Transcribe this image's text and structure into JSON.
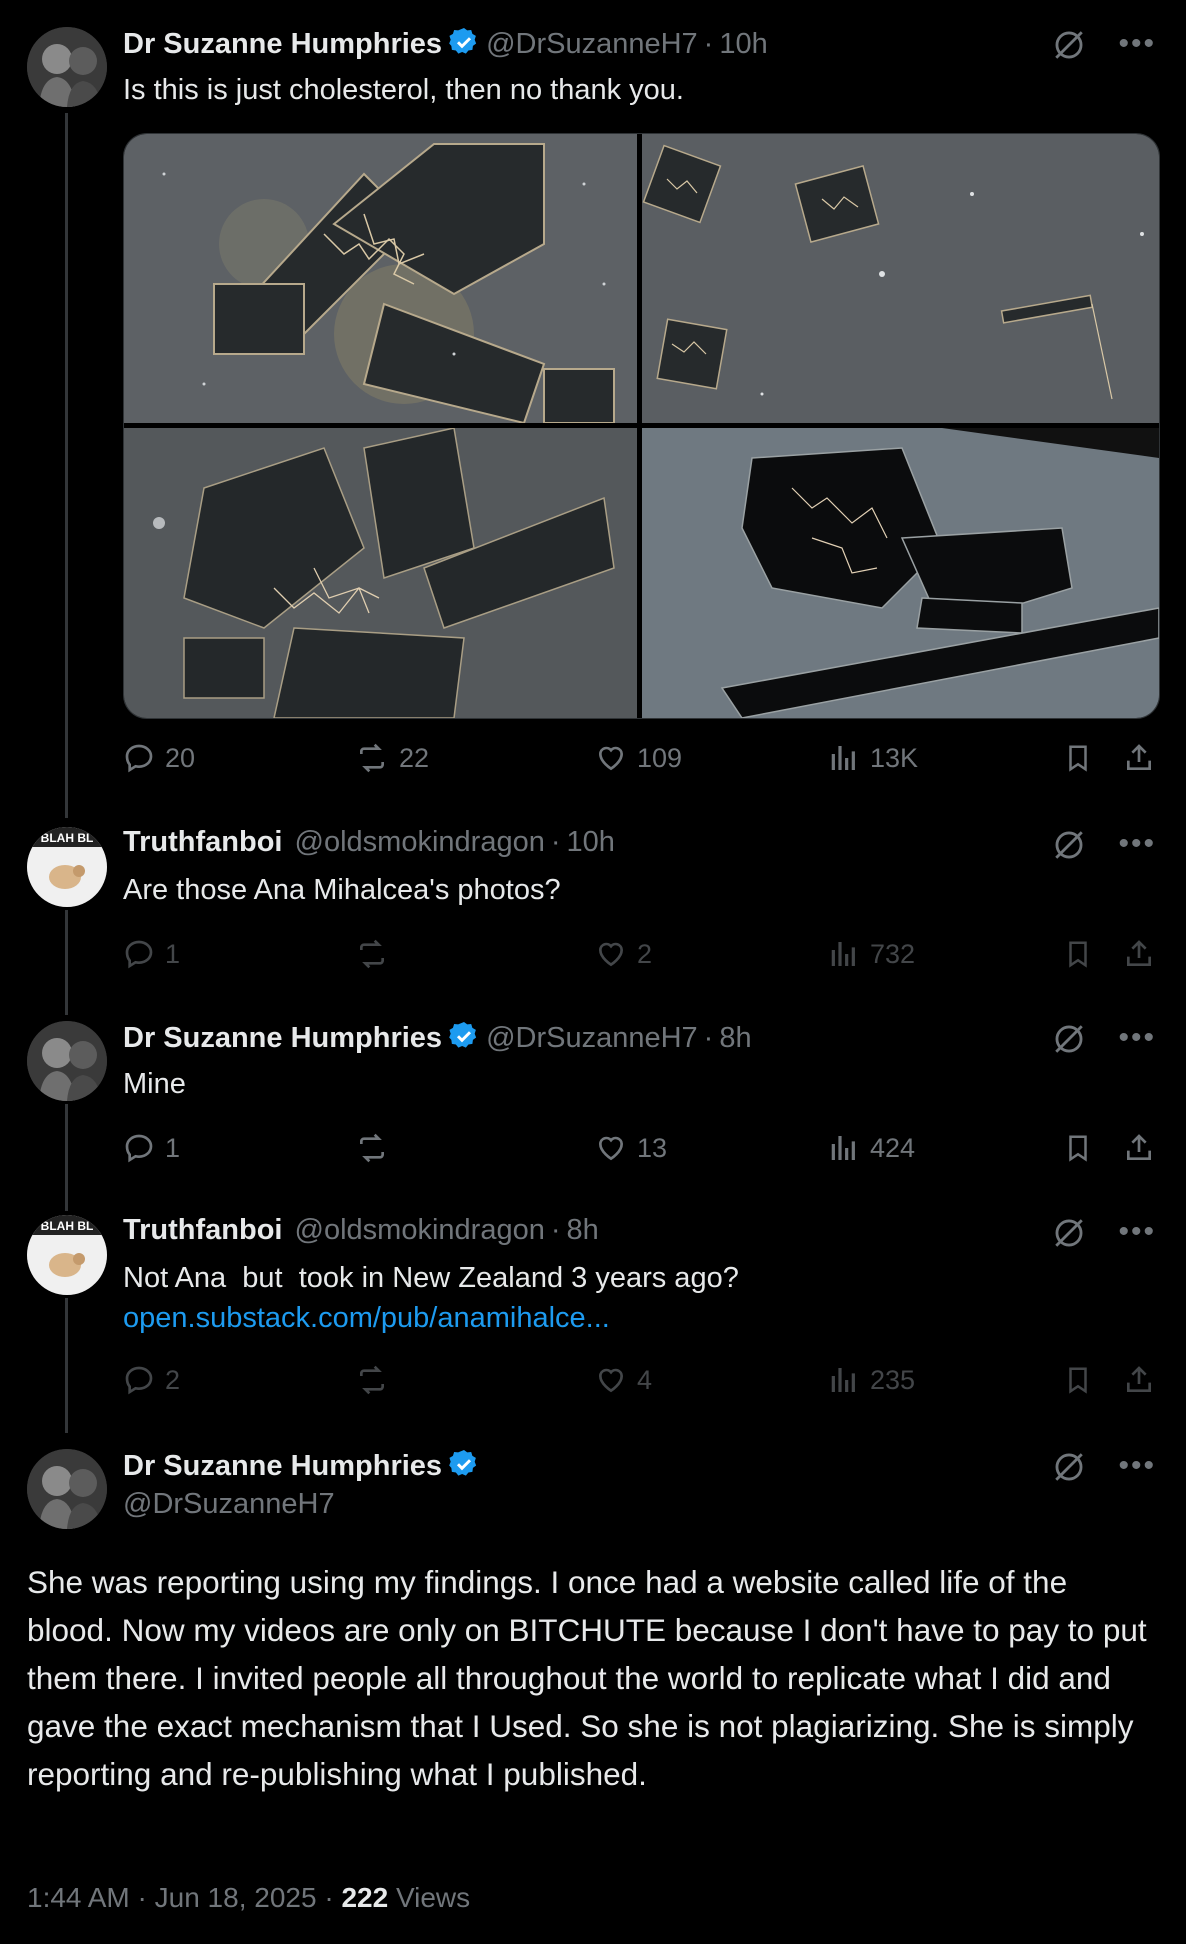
{
  "tweets": [
    {
      "name": "Dr Suzanne Humphries",
      "handle": "@DrSuzanneH7",
      "time": "10h",
      "text": "Is this is just cholesterol, then no thank you.",
      "replies": "20",
      "reposts": "22",
      "likes": "109",
      "views": "13K"
    },
    {
      "name": "Truthfanboi",
      "handle": "@oldsmokindragon",
      "time": "10h",
      "text": "Are those Ana Mihalcea's photos?",
      "replies": "1",
      "reposts": "",
      "likes": "2",
      "views": "732"
    },
    {
      "name": "Dr Suzanne Humphries",
      "handle": "@DrSuzanneH7",
      "time": "8h",
      "text": "Mine",
      "replies": "1",
      "reposts": "",
      "likes": "13",
      "views": "424"
    },
    {
      "name": "Truthfanboi",
      "handle": "@oldsmokindragon",
      "time": "8h",
      "text": "Not Ana  but  took in New Zealand 3 years ago?",
      "link": "open.substack.com/pub/anamihalce...",
      "replies": "2",
      "reposts": "",
      "likes": "4",
      "views": "235"
    }
  ],
  "main_tweet": {
    "name": "Dr Suzanne Humphries",
    "handle": "@DrSuzanneH7",
    "text": "She was reporting using my findings. I once had a website called life of the blood. Now my videos are only on BITCHUTE because I don't have to pay to put them there. I invited people all throughout the world to replicate what I did and gave the exact mechanism that I Used. So she is not plagiarizing. She is simply reporting and re-publishing what I published.",
    "time": "1:44 AM",
    "date": "Jun 18, 2025",
    "views_count": "222",
    "views_label": "Views"
  },
  "avatar_badge_text": "BLAH BL",
  "separator": "·",
  "colors": {
    "background": "#000000",
    "text": "#e7e9ea",
    "secondary": "#71767b",
    "link": "#1d9bf0",
    "verified": "#1d9bf0"
  },
  "icons": [
    "verified-badge-icon",
    "grok-icon",
    "more-icon",
    "reply-icon",
    "repost-icon",
    "like-icon",
    "views-icon",
    "bookmark-icon",
    "share-icon"
  ]
}
